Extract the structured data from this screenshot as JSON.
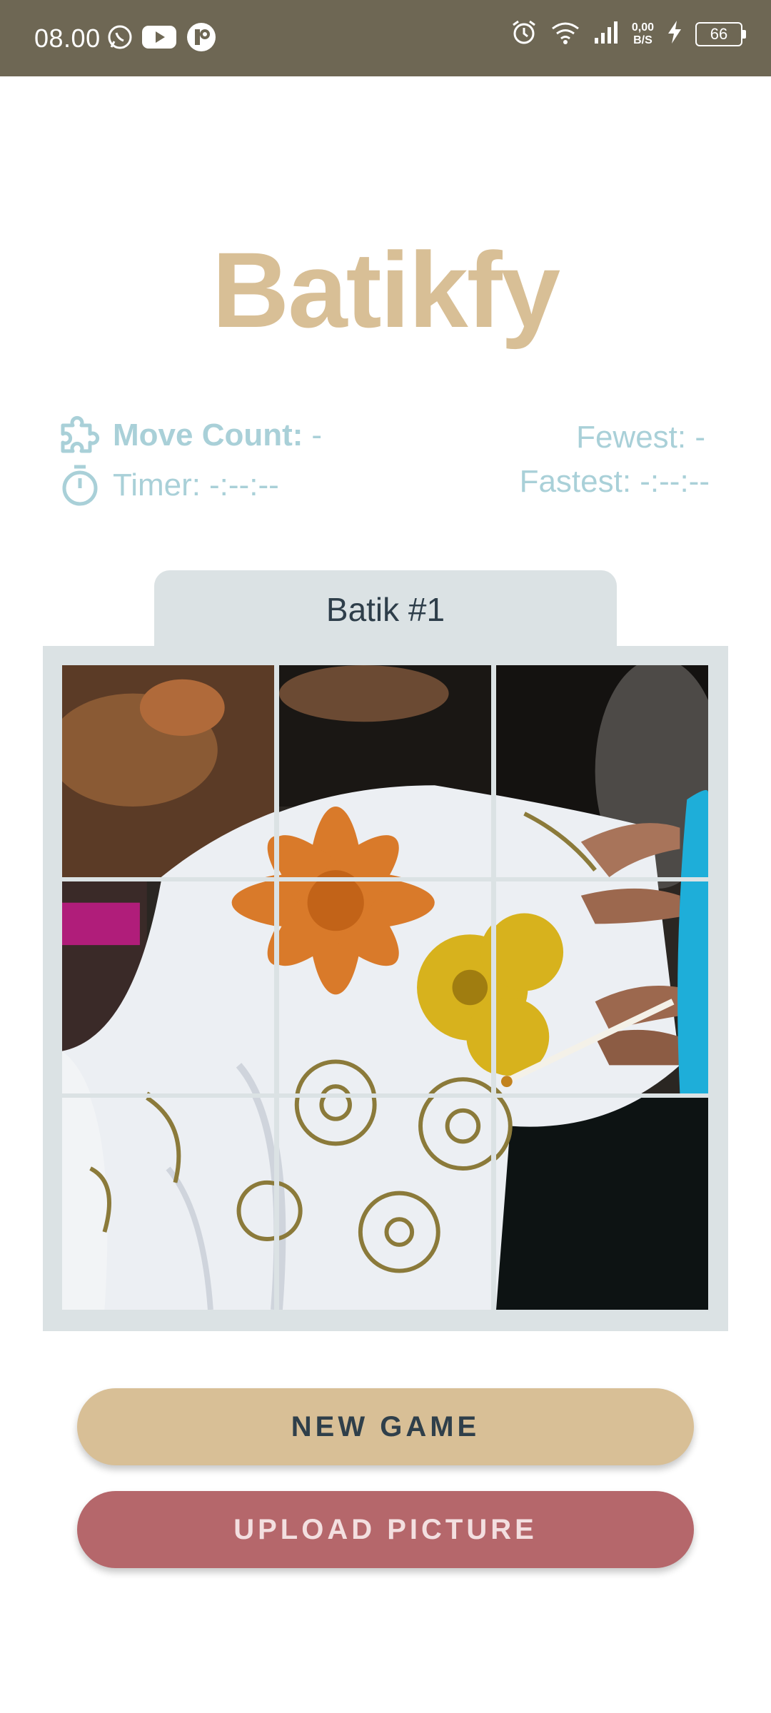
{
  "status_bar": {
    "time": "08.00",
    "speed_value": "0,00",
    "speed_unit": "B/S",
    "battery": "66"
  },
  "app": {
    "title": "Batikfy"
  },
  "stats": {
    "move_count_label": "Move Count:",
    "move_count_value": "-",
    "timer_label": "Timer:",
    "timer_value": "-:--:--",
    "fewest": "Fewest: -",
    "fastest": "Fastest: -:--:--"
  },
  "board": {
    "title": "Batik #1",
    "tiles": [
      "tile-1",
      "tile-2",
      "tile-3",
      "tile-4",
      "tile-5",
      "tile-6",
      "tile-7",
      "tile-8",
      "empty-tile"
    ]
  },
  "buttons": {
    "new_game": "NEW GAME",
    "upload_picture": "UPLOAD PICTURE"
  },
  "colors": {
    "status_bar": "#6e6754",
    "title": "#d8bf96",
    "stat_text": "#a9d0d8",
    "board_bg": "#dbe2e4",
    "new_game_button": "#d8bf96",
    "upload_button": "#b5676b"
  }
}
